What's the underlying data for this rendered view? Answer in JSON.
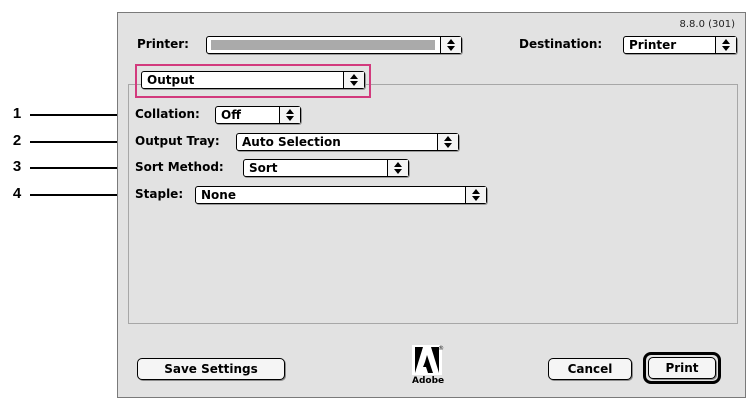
{
  "dialog": {
    "version": "8.8.0 (301)",
    "printer_label": "Printer:",
    "destination_label": "Destination:",
    "destination_value": "Printer",
    "panel_value": "Output"
  },
  "settings": [
    {
      "callout": "1",
      "label": "Collation:",
      "value": "Off"
    },
    {
      "callout": "2",
      "label": "Output Tray:",
      "value": "Auto Selection"
    },
    {
      "callout": "3",
      "label": "Sort Method:",
      "value": "Sort"
    },
    {
      "callout": "4",
      "label": "Staple:",
      "value": "None"
    }
  ],
  "buttons": {
    "save": "Save Settings",
    "cancel": "Cancel",
    "print": "Print"
  },
  "logo": {
    "name": "Adobe",
    "registered": "®"
  },
  "icons": {
    "popup_arrows": "up-down-arrows-icon",
    "logo": "adobe-logo"
  },
  "colors": {
    "highlight": "#d23a7d",
    "dialog_bg": "#e2e2e2"
  }
}
